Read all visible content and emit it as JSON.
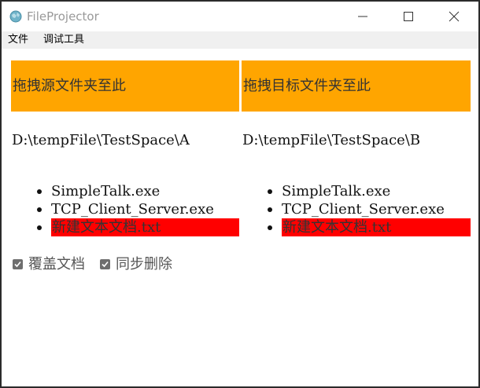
{
  "window": {
    "title": "FileProjector",
    "icon": "app-globe-icon"
  },
  "menu": {
    "items": [
      "文件",
      "调试工具"
    ]
  },
  "source": {
    "drop_label": "拖拽源文件夹至此",
    "path": "D:\\tempFile\\TestSpace\\A",
    "files": [
      "SimpleTalk.exe",
      "TCP_Client_Server.exe",
      "新建文本文档.txt"
    ]
  },
  "target": {
    "drop_label": "拖拽目标文件夹至此",
    "path": "D:\\tempFile\\TestSpace\\B",
    "files": [
      "SimpleTalk.exe",
      "TCP_Client_Server.exe",
      "新建文本文档.txt"
    ]
  },
  "options": [
    {
      "label": "覆盖文档",
      "checked": true
    },
    {
      "label": "同步删除",
      "checked": true
    }
  ],
  "colors": {
    "drop_zone": "#ffa500",
    "highlight": "#ff0000"
  }
}
